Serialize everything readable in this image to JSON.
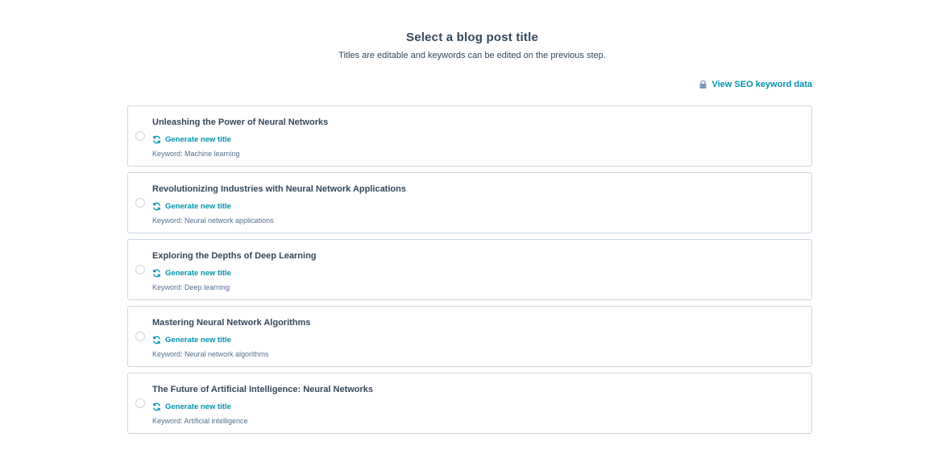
{
  "header": {
    "title": "Select a blog post title",
    "subtitle": "Titles are editable and keywords can be edited on the previous step."
  },
  "seo_link": {
    "label": "View SEO keyword data",
    "icon": "lock-icon"
  },
  "accent_color": "#0091ae",
  "options": [
    {
      "title": "Unleashing the Power of Neural Networks",
      "regenerate_label": "Generate new title",
      "keyword": "Keyword: Machine learning"
    },
    {
      "title": "Revolutionizing Industries with Neural Network Applications",
      "regenerate_label": "Generate new title",
      "keyword": "Keyword: Neural network applications"
    },
    {
      "title": "Exploring the Depths of Deep Learning",
      "regenerate_label": "Generate new title",
      "keyword": "Keyword: Deep learning"
    },
    {
      "title": "Mastering Neural Network Algorithms",
      "regenerate_label": "Generate new title",
      "keyword": "Keyword: Neural network algorithms"
    },
    {
      "title": "The Future of Artificial Intelligence: Neural Networks",
      "regenerate_label": "Generate new title",
      "keyword": "Keyword: Artificial intelligence"
    }
  ]
}
